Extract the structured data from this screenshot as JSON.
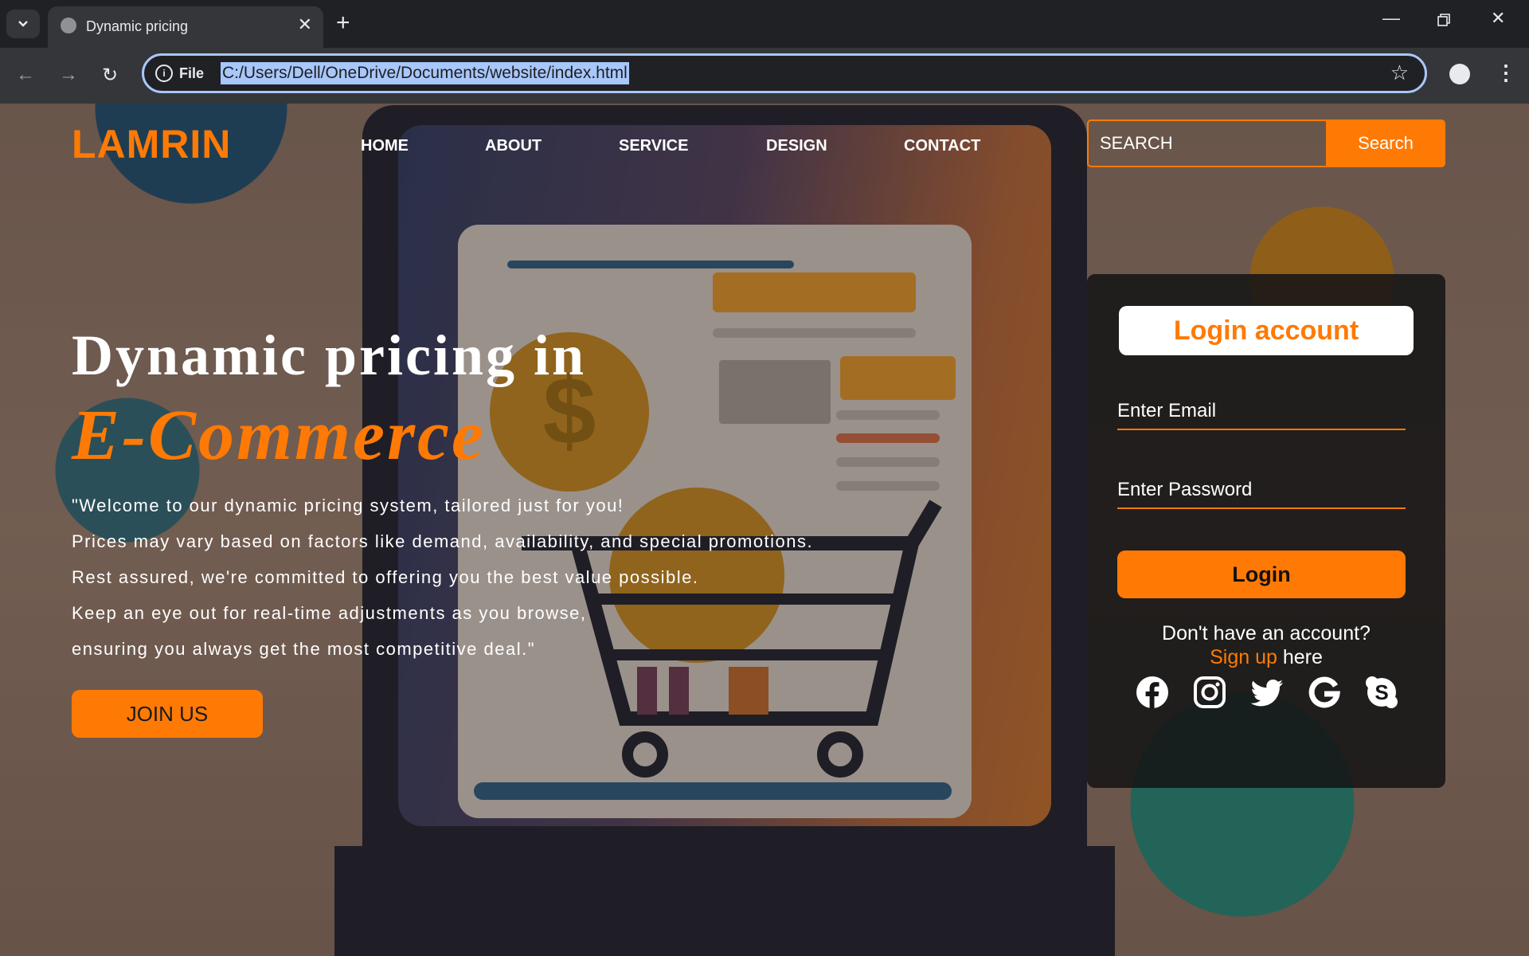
{
  "browser": {
    "tab_title": "Dynamic pricing",
    "new_tab": "+",
    "url_scheme": "File",
    "url": "C:/Users/Dell/OneDrive/Documents/website/index.html"
  },
  "site": {
    "logo": "LAMRIN",
    "nav": [
      "HOME",
      "ABOUT",
      "SERVICE",
      "DESIGN",
      "CONTACT"
    ],
    "search": {
      "placeholder": "SEARCH",
      "button": "Search"
    }
  },
  "hero": {
    "heading_line1": "Dynamic pricing in",
    "heading_line2": "E-Commerce",
    "paragraph": [
      "\"Welcome to our dynamic pricing system, tailored just for you!",
      "Prices may vary based on factors like demand, availability, and special promotions.",
      "Rest assured, we're committed to offering you the best value possible.",
      "Keep an eye out for real-time adjustments as you browse,",
      "ensuring you always get the most competitive deal.\""
    ],
    "cta": "JOIN US"
  },
  "login": {
    "title": "Login account",
    "email_placeholder": "Enter Email",
    "password_placeholder": "Enter Password",
    "button": "Login",
    "question": "Don't have an account?",
    "signup_link": "Sign up",
    "signup_suffix": " here",
    "social_icons": [
      "facebook-icon",
      "instagram-icon",
      "twitter-icon",
      "google-icon",
      "skype-icon"
    ]
  },
  "colors": {
    "accent": "#ff7a05",
    "panel": "#161616",
    "browser_frame": "#35363a"
  }
}
